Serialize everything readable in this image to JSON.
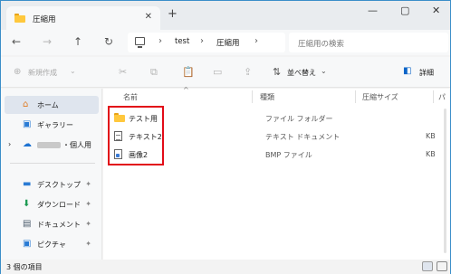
{
  "colors": {
    "accent": "#0a64c8",
    "highlight_box": "#e20c18",
    "folder": "#ffc83d"
  },
  "tab": {
    "title": "圧縮用",
    "close_label": "✕",
    "new_tab_label": "+"
  },
  "window_buttons": {
    "minimize": "—",
    "maximize": "▢",
    "close": "✕"
  },
  "address": {
    "crumbs": [
      "test",
      "圧縮用"
    ],
    "separator": "›",
    "search_placeholder": "圧縮用の検索"
  },
  "toolbar": {
    "new_label": "新規作成",
    "sort_label": "並べ替え",
    "details_label": "詳細"
  },
  "sidebar": {
    "items": [
      {
        "label": "ホーム",
        "icon": "home-icon"
      },
      {
        "label": "ギャラリー",
        "icon": "gallery-icon"
      },
      {
        "label": "・個人用",
        "icon": "cloud-icon"
      },
      {
        "label": "デスクトップ",
        "icon": "desktop-icon"
      },
      {
        "label": "ダウンロード",
        "icon": "download-icon"
      },
      {
        "label": "ドキュメント",
        "icon": "documents-icon"
      },
      {
        "label": "ピクチャ",
        "icon": "pictures-icon"
      }
    ],
    "pin": "📌"
  },
  "content": {
    "columns": [
      "名前",
      "種類",
      "圧縮サイズ",
      "パ"
    ],
    "rows": [
      {
        "name": "テスト用",
        "type": "ファイル フォルダー",
        "size": "",
        "icon": "folder-icon"
      },
      {
        "name": "テキスト2",
        "type": "テキスト ドキュメント",
        "size": "KB",
        "icon": "text-file-icon"
      },
      {
        "name": "画像2",
        "type": "BMP ファイル",
        "size": "KB",
        "icon": "image-file-icon"
      }
    ]
  },
  "status": {
    "count": "3 個の項目"
  }
}
